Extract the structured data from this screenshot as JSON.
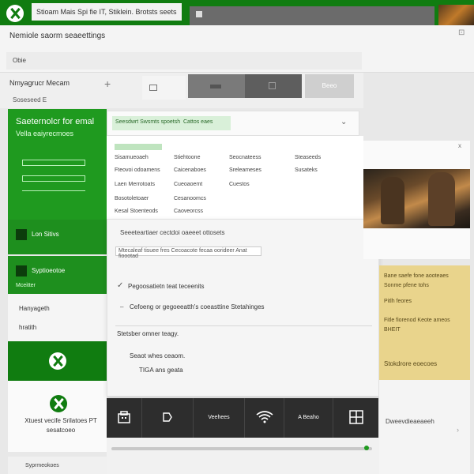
{
  "topbar": {
    "tab_text": "Stioam Mais Spi fie IT, Stiklein. Brotsts seets",
    "brand_color": "#107c10"
  },
  "header": {
    "title": "Nemiole saorm seaeettings",
    "filter_label": "Obie"
  },
  "subrow": {
    "label1": "Nmyagrucr Mecam",
    "plus": "+",
    "label2": "Soseseed E",
    "tools": {
      "btn4": "Beeo"
    }
  },
  "greenpanel": {
    "title": "Saeternolcr for emal",
    "subtitle": "Vella eaiyrecmoes"
  },
  "greenitems": [
    {
      "label": "Lon Sitivs"
    },
    {
      "label": "Syptioeotoe",
      "sub": "Mceitter"
    }
  ],
  "leftlist": {
    "item1": "Hanyageth",
    "item2": "hratith"
  },
  "leftwhite": {
    "line1": "Xtuest vecife Srilatoes PT",
    "line2": "sesatcoeo"
  },
  "bottomleft": {
    "label": "Syprmeokoes"
  },
  "midtop": {
    "pill1": "Seesdwrt Swsmts spoetsh",
    "pill2": "Cattos eaes"
  },
  "midgrid": {
    "header": "Sreuniacls",
    "col1": [
      "Sisamueoaeh",
      "Fteovoi odoamens",
      "Laen Merrotoats",
      "Bosotoletoaer",
      "Kesal Stoenteods"
    ],
    "col2": [
      "Stiehtoone",
      "Caicenaboes",
      "Cueoaoemt",
      "Cesanoomcs",
      "Caoveorcss"
    ],
    "col3": [
      "Seocnateess",
      "Sreleameses",
      "Cuestos"
    ],
    "col4": [
      "Steaseeds",
      "Susateks"
    ]
  },
  "popup": {
    "line1": "Seeeteartiaer cectdoi oaeeet ottosets",
    "field": "Mtecaleaf tisuee fres Cecoacote fecaa oorideer Anat fioootad",
    "check": "✓",
    "line2": "Pegoosatietn teat teceenits",
    "dash": "–",
    "line3": "Cefoeng or gegoeeatth's coeasttine Stetahinges",
    "line4": "Stetsber omner teagy.",
    "line5": "Seaot whes ceaom.",
    "line6": "TIGA ans geata"
  },
  "taskbar": {
    "items": [
      {
        "name": "store-icon",
        "label": ""
      },
      {
        "name": "tag-icon",
        "label": ""
      },
      {
        "name": "tb-label",
        "label": "Veehees"
      },
      {
        "name": "wifi-icon",
        "label": ""
      },
      {
        "name": "tb-label-2",
        "label": "A Beaho"
      },
      {
        "name": "windows-icon",
        "label": ""
      }
    ]
  },
  "rightimg": {
    "close": "x"
  },
  "rightyellow": {
    "l1": "Bane saefe fone aooteaes",
    "l2": "Sonme pfene tohs",
    "l3": "Pitlh feores",
    "l4": "Fitle fiorenod Keote ameos",
    "l5": "BHEIT",
    "l6": "Stokdrore eoecoes"
  },
  "rightwhite": {
    "l1": "Dweevdieaeaeeh",
    "chev": "›"
  },
  "accent_colors": {
    "green": "#107c10",
    "light_green": "#1f9a1f",
    "yellow": "#e9d48c",
    "dark": "#2d2d2d"
  }
}
